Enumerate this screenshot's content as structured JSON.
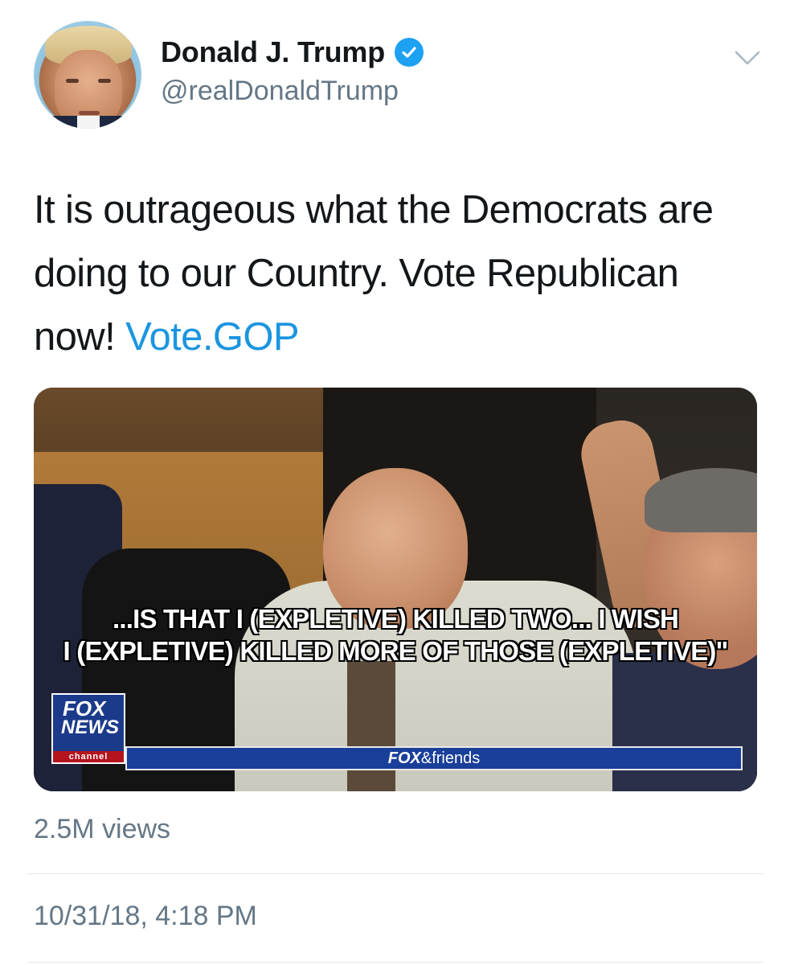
{
  "author": {
    "display_name": "Donald J. Trump",
    "handle": "@realDonaldTrump",
    "verified": true
  },
  "tweet": {
    "text_before_link": "It is outrageous what the Democrats are doing to our Country. Vote Republican now! ",
    "link_text": "Vote.GOP"
  },
  "media": {
    "subtitle_line1": "...IS THAT I (EXPLETIVE) KILLED TWO... I WISH",
    "subtitle_line2": "I (EXPLETIVE) KILLED MORE OF THOSE (EXPLETIVE)\"",
    "logo_fox": "FOX",
    "logo_news": "NEWS",
    "logo_channel": "channel",
    "bar_brand": "FOX",
    "bar_show": "&friends"
  },
  "stats": {
    "views": "2.5M views",
    "timestamp": "10/31/18, 4:18 PM"
  },
  "colors": {
    "link": "#1b95e0",
    "verified": "#1da1f2",
    "muted": "#657786"
  },
  "icons": [
    "verified-badge-icon",
    "chevron-down-icon"
  ]
}
